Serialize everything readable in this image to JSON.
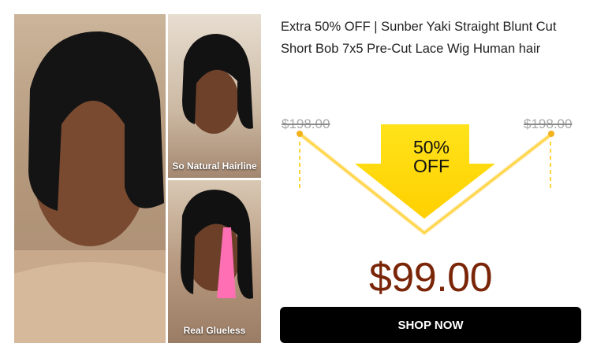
{
  "product": {
    "title": "Extra 50% OFF | Sunber Yaki Straight Blunt Cut Short Bob 7x5 Pre-Cut Lace Wig Human hair",
    "original_price_left": "$198.00",
    "original_price_right": "$198.00",
    "discount_line1": "50%",
    "discount_line2": "OFF",
    "sale_price": "$99.00",
    "cta_label": "SHOP NOW"
  },
  "gallery": {
    "captions": [
      "So Natural Hairline",
      "Real Glueless"
    ]
  },
  "colors": {
    "arrow_yellow": "#ffd400",
    "sale_price": "#7a2508",
    "cta_background": "#000000",
    "struck_price": "#a8a8a8"
  }
}
